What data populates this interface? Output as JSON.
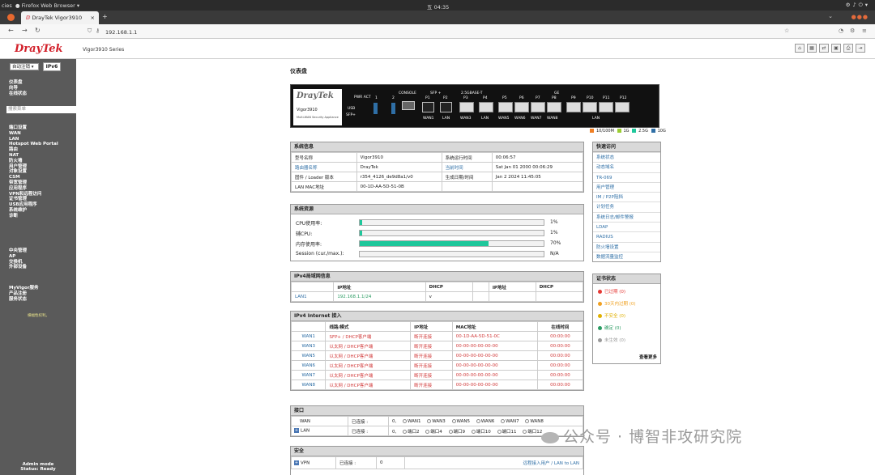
{
  "os_bar": {
    "activities": "cies",
    "browser_label": "Firefox Web Browser ▾",
    "clock": "五 04:35"
  },
  "tab": {
    "title": "DrayTek Vigor3910",
    "close": "×",
    "new": "+"
  },
  "nav": {
    "url": "192.168.1.1"
  },
  "header": {
    "logo": "DrayTek",
    "model": "Vigor3910 Series"
  },
  "sidebar": {
    "mode_select": "自动注销 ▾",
    "ipv6": "IPv6",
    "group1": [
      "仪表盘",
      "向导",
      "在线状态"
    ],
    "search_placeholder": "搜索菜单",
    "group2": [
      "端口设置",
      "WAN",
      "LAN",
      "Hotspot Web Portal",
      "路由",
      "NAT",
      "防火墙",
      "用户管理",
      "对象设置",
      "CSM",
      "带宽管理",
      "应用程序",
      "VPN和远程访问",
      "证书管理",
      "USB应用程序",
      "系统维护",
      "诊断"
    ],
    "group3": [
      "中央管理",
      "AP",
      "交换机",
      "外部设备"
    ],
    "group4": [
      "MyVigor服务",
      "产品注册",
      "服务状态"
    ],
    "note": "横幅性权利。",
    "footer_mode": "Admin mode",
    "footer_status": "Status: Ready"
  },
  "page_title": "仪表盘",
  "device": {
    "plate_logo": "DrayTek",
    "plate_model": "Vigor3910",
    "plate_sub": "Multi-WAN Security Appliance",
    "pwr_act": "PWR ACT",
    "usb": "USB",
    "sfp": "SFP+",
    "console": "CONSOLE",
    "sfp_plus": "SFP +",
    "base_t": "2.5GBASE-T",
    "ge": "GE",
    "port_top": [
      "P1",
      "P2",
      "P3",
      "P4",
      "P5",
      "P6",
      "P7",
      "P8",
      "P9",
      "P10",
      "P11",
      "P12"
    ],
    "port_bottom": [
      "WAN1",
      "LAN",
      "WAN3",
      "LAN",
      "WAN5",
      "WAN6",
      "WAN7",
      "WAN8",
      "LAN"
    ],
    "usb_ports": [
      "1",
      "2"
    ]
  },
  "legend": [
    {
      "label": "10/100M",
      "color": "#f07f23"
    },
    {
      "label": "1G",
      "color": "#9acd32"
    },
    {
      "label": "2.5G",
      "color": "#1ec79b"
    },
    {
      "label": "10G",
      "color": "#2f6fa6"
    }
  ],
  "sysinfo": {
    "title": "系统信息",
    "rows": [
      [
        "型号名称",
        "Vigor3910",
        "系统运行时间",
        "00:06:57"
      ],
      [
        "路由器名称",
        "DrayTek",
        "当前时间",
        "Sat Jan 01 2000 00:06:29"
      ],
      [
        "固件 / Loader 版本",
        "r354_4126_de9d8a1/v0",
        "生成日期/时间",
        "Jan 2 2024 11:45:05"
      ],
      [
        "LAN MAC地址",
        "00-1D-AA-5D-51-0B",
        "",
        ""
      ]
    ]
  },
  "resources": {
    "title": "系统资源",
    "rows": [
      {
        "label": "CPU使用率:",
        "value": "1%",
        "pct": 1
      },
      {
        "label": "辅CPU:",
        "value": "1%",
        "pct": 1
      },
      {
        "label": "内存使用率:",
        "value": "70%",
        "pct": 70
      },
      {
        "label": "Session (cur./max.):",
        "value": "N/A",
        "pct": 0
      }
    ]
  },
  "lan": {
    "title": "IPv4局域网信息",
    "headers": [
      "",
      "IP地址",
      "DHCP",
      "",
      "IP地址",
      "DHCP"
    ],
    "rows": [
      [
        "LAN1",
        "192.168.1.1/24",
        "v",
        "",
        "",
        ""
      ]
    ]
  },
  "wan": {
    "title": "IPv4 Internet 接入",
    "headers": [
      "",
      "线路/模式",
      "IP地址",
      "MAC地址",
      "在线时间"
    ],
    "rows": [
      [
        "WAN1",
        "SFP+ / DHCP客户端",
        "断开连接",
        "00-1D-AA-5D-51-0C",
        "00:00:00"
      ],
      [
        "WAN3",
        "以太网 / DHCP客户端",
        "断开连接",
        "00-00-00-00-00-00",
        "00:00:00"
      ],
      [
        "WAN5",
        "以太网 / DHCP客户端",
        "断开连接",
        "00-00-00-00-00-00",
        "00:00:00"
      ],
      [
        "WAN6",
        "以太网 / DHCP客户端",
        "断开连接",
        "00-00-00-00-00-00",
        "00:00:00"
      ],
      [
        "WAN7",
        "以太网 / DHCP客户端",
        "断开连接",
        "00-00-00-00-00-00",
        "00:00:00"
      ],
      [
        "WAN8",
        "以太网 / DHCP客户端",
        "断开连接",
        "00-00-00-00-00-00",
        "00:00:00"
      ]
    ]
  },
  "iface": {
    "title": "接口",
    "wan_label": "WAN",
    "wan_status": "已连接 :",
    "wan_count": "0,",
    "wan_items": [
      "WAN1",
      "WAN3",
      "WAN5",
      "WAN6",
      "WAN7",
      "WAN8"
    ],
    "lan_label": "LAN",
    "lan_status": "已连接 :",
    "lan_count": "0,",
    "lan_items": [
      "端口2",
      "端口4",
      "端口9",
      "端口10",
      "端口11",
      "端口12"
    ]
  },
  "security": {
    "title": "安全",
    "vpn_label": "VPN",
    "vpn_status": "已连接 :",
    "vpn_count": "0",
    "links": "远程接入用户 / LAN to LAN"
  },
  "quick": {
    "title": "快速访问",
    "items": [
      "系统状态",
      "动态域名",
      "TR-069",
      "用户管理",
      "IM / P2P阻挡",
      "计划任务",
      "系统日志/邮件警报",
      "LDAP",
      "RADIUS",
      "防火墙设置",
      "数据流量监控"
    ]
  },
  "cert": {
    "title": "证书状态",
    "items": [
      {
        "label": "已过期",
        "count": "(0)",
        "color": "#e53935"
      },
      {
        "label": "30天内过期",
        "count": "(0)",
        "color": "#f0a020"
      },
      {
        "label": "不安全",
        "count": "(0)",
        "color": "#e0b000"
      },
      {
        "label": "确定",
        "count": "(0)",
        "color": "#2a9b62"
      },
      {
        "label": "未生效",
        "count": "(0)",
        "color": "#999999"
      }
    ],
    "more": "查看更多"
  },
  "watermark": "公众号 · 博智非攻研究院"
}
